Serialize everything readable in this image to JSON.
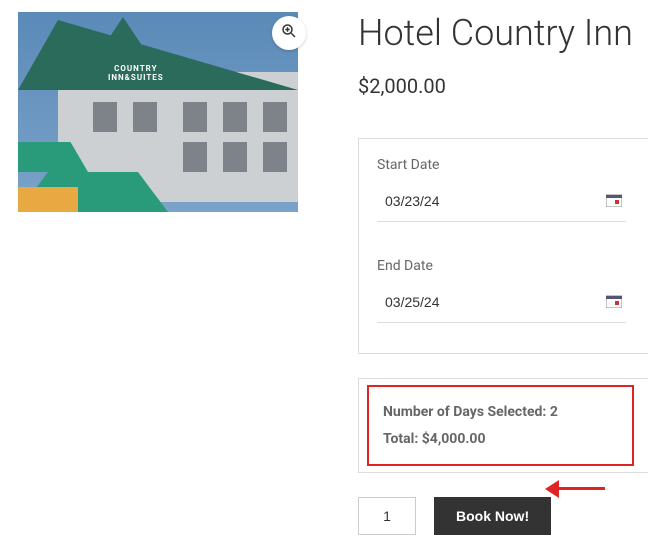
{
  "product": {
    "title": "Hotel Country Inn",
    "price": "$2,000.00",
    "image_alt": "Country Inn & Suites hotel exterior",
    "logo_text": "COUNTRY\nINN&SUITES"
  },
  "booking": {
    "start_label": "Start Date",
    "start_value": "03/23/24",
    "end_label": "End Date",
    "end_value": "03/25/24"
  },
  "summary": {
    "days_label": "Number of Days Selected: ",
    "days_value": "2",
    "total_label": "Total: ",
    "total_value": "$4,000.00"
  },
  "actions": {
    "qty": "1",
    "book_label": "Book Now!"
  },
  "icons": {
    "magnify": "⚲",
    "calendar": "📅"
  }
}
